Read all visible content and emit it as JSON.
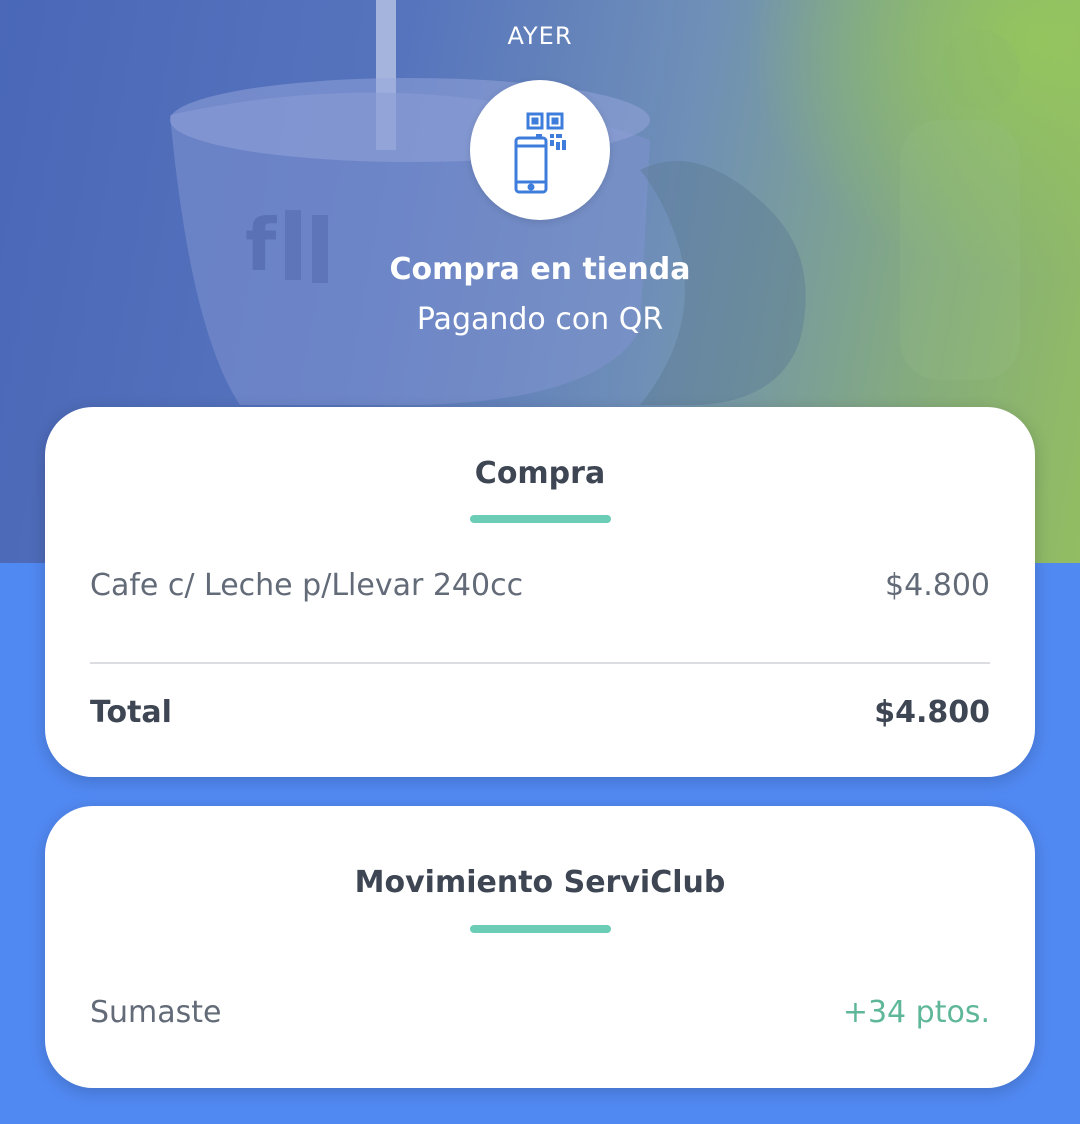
{
  "hero": {
    "date_label": "AYER",
    "icon": "qr-phone-icon",
    "title": "Compra en tienda",
    "subtitle": "Pagando con QR"
  },
  "purchase_card": {
    "heading": "Compra",
    "items": [
      {
        "name": "Cafe c/ Leche p/Llevar 240cc",
        "amount": "$4.800"
      }
    ],
    "total_label": "Total",
    "total_amount": "$4.800"
  },
  "club_card": {
    "heading": "Movimiento ServiClub",
    "label": "Sumaste",
    "points": "+34 ptos."
  },
  "colors": {
    "accent_teal": "#6ccdb6",
    "points_green": "#5fb799",
    "background_blue": "#5189f2",
    "icon_blue": "#3e7ddc"
  }
}
